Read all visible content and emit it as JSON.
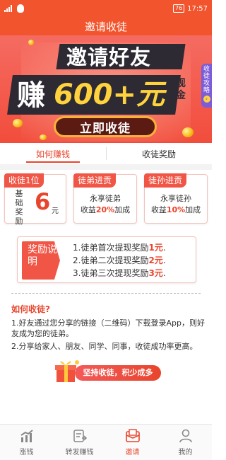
{
  "status_bar": {
    "battery": "76",
    "time": "17:57"
  },
  "header": {
    "title": "邀请收徒"
  },
  "banner": {
    "line1": "邀请好友",
    "earn": "赚",
    "amount": "600+元",
    "cash": "现金",
    "side_tab": "收徒攻略",
    "side_arrow": "›",
    "cta": "立即收徒"
  },
  "tabs": [
    {
      "label": "如何赚钱",
      "active": true
    },
    {
      "label": "收徒奖励",
      "active": false
    }
  ],
  "cards": {
    "c1": {
      "title": "收徒1位",
      "label": "基础奖励",
      "num": "6",
      "unit": "元"
    },
    "c2": {
      "title": "徒弟进贡",
      "line1": "永享徒弟",
      "pre": "收益",
      "pct": "20%",
      "post": "加成"
    },
    "c3": {
      "title": "徒孙进贡",
      "line1": "永享徒孙",
      "pre": "收益",
      "pct": "10%",
      "post": "加成"
    }
  },
  "reward": {
    "tag": "奖励说明",
    "items": [
      {
        "pre": "1.徒弟首次提现奖励",
        "amt": "1元",
        "post": "."
      },
      {
        "pre": "2.徒弟二次提现奖励",
        "amt": "2元",
        "post": "."
      },
      {
        "pre": "3.徒弟三次提现奖励",
        "amt": "3元",
        "post": "."
      }
    ]
  },
  "howto": {
    "title": "如何收徒?",
    "p1": "1.好友通过您分享的链接（二维码）下载登录App，则好友成为您的徒弟。",
    "p2": "2.分享给家人、朋友、同学、同事，收徒成功率更高。"
  },
  "persist": {
    "label": "坚持收徒，积少成多"
  },
  "nav": [
    {
      "label": "涨钱",
      "icon": "trend-icon"
    },
    {
      "label": "转发赚钱",
      "icon": "share-doc-icon"
    },
    {
      "label": "邀请",
      "icon": "invite-envelope-icon",
      "active": true
    },
    {
      "label": "我的",
      "icon": "user-icon"
    }
  ],
  "colors": {
    "primary": "#f2542d",
    "accent": "#e8452c",
    "dark": "#2d2a33",
    "gold": "#ffd33d",
    "purple": "#7c5cd9"
  }
}
